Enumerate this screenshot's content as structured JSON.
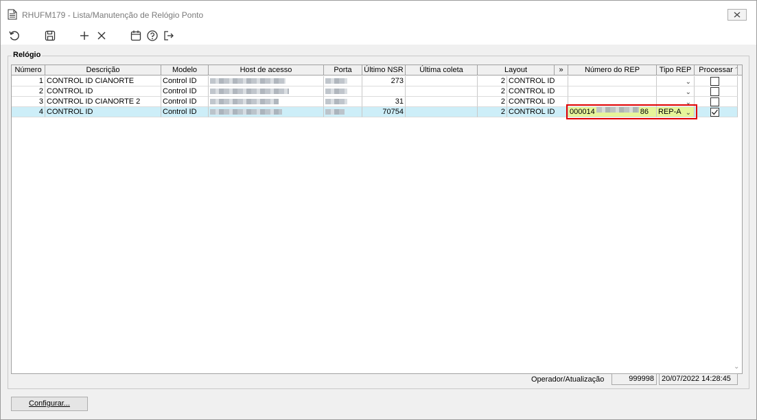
{
  "window": {
    "title": "RHUFM179 - Lista/Manutenção de Relógio Ponto",
    "close_icon": "close-icon"
  },
  "toolbar": {
    "icons": [
      "refresh-icon",
      "save-icon",
      "add-icon",
      "delete-icon",
      "calendar-icon",
      "help-icon",
      "exit-icon"
    ]
  },
  "group": {
    "legend": "Relógio"
  },
  "grid": {
    "columns": [
      "Número",
      "Descrição",
      "Modelo",
      "Host de acesso",
      "Porta",
      "Último NSR",
      "Última coleta",
      "Layout",
      "»",
      "Número do REP",
      "Tipo REP",
      "Processar"
    ],
    "rows": [
      {
        "numero": "1",
        "descricao": "CONTROL ID CIANORTE",
        "modelo": "Control ID",
        "ultimo_nsr": "273",
        "layout_num": "2",
        "layout": "CONTROL ID",
        "numero_rep": "",
        "tipo_rep": "",
        "processar": false
      },
      {
        "numero": "2",
        "descricao": "CONTROL ID",
        "modelo": "Control ID",
        "ultimo_nsr": "",
        "layout_num": "2",
        "layout": "CONTROL ID",
        "numero_rep": "",
        "tipo_rep": "",
        "processar": false
      },
      {
        "numero": "3",
        "descricao": "CONTROL ID CIANORTE 2",
        "modelo": "Control ID",
        "ultimo_nsr": "31",
        "layout_num": "2",
        "layout": "CONTROL ID",
        "numero_rep": "",
        "tipo_rep": "",
        "processar": false
      },
      {
        "numero": "4",
        "descricao": "CONTROL ID",
        "modelo": "Control ID",
        "ultimo_nsr": "70754",
        "layout_num": "2",
        "layout": "CONTROL ID",
        "numero_rep_prefix": "000014",
        "numero_rep_suffix": "86",
        "tipo_rep": "REP-A",
        "processar": true
      }
    ],
    "highlight_color": "#e00000",
    "selected_row_color": "#cdeef8",
    "rep_field_color": "#e6f59a"
  },
  "footer": {
    "label": "Operador/Atualização",
    "operator": "999998",
    "timestamp": "20/07/2022 14:28:45"
  },
  "buttons": {
    "configurar": "Configurar..."
  }
}
